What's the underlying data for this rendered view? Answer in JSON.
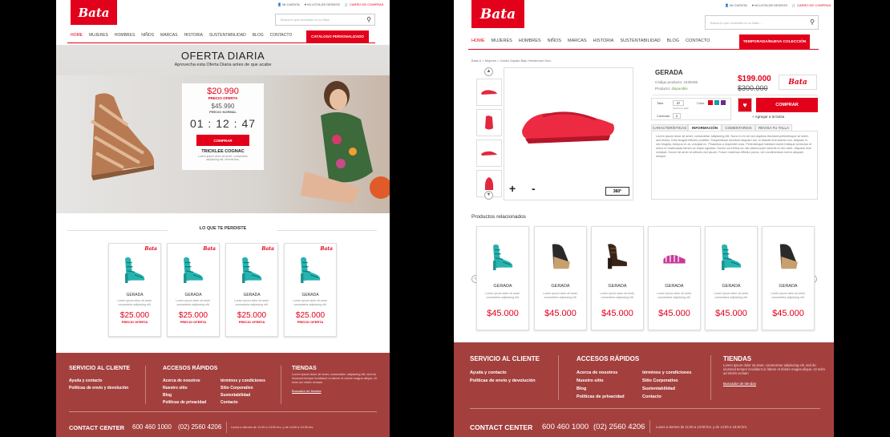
{
  "brand": {
    "logo": "Bata",
    "accent": "#e2001a",
    "footer_bg": "#a3403e"
  },
  "topbar": {
    "account": "MI CUENTA",
    "wishlist": "MI LISTA DE DESEOS",
    "cart": "CARRO DE COMPRAS"
  },
  "search": {
    "placeholder": "Busca lo que necesites en tu Bata...",
    "placeholder2": "Busca lo que necesites en tu Bata..."
  },
  "nav": {
    "items": [
      "HOME",
      "MUJERES",
      "HOMBRES",
      "NIÑOS",
      "MARCAS",
      "HISTORIA",
      "SUSTENTABILIDAD",
      "BLOG",
      "CONTACTO"
    ],
    "cta1": "CATÁLOGO PERSONALIZADO",
    "cta2": "TEMPORADA/NUEVA COLECCIÓN"
  },
  "offer": {
    "title": "OFERTA DIARIA",
    "subtitle": "Aprovecha esta Oferta Diaria antes de que acabe",
    "price": "$20.990",
    "price_label": "PRECIO OFERTA",
    "normal_price": "$45.990",
    "normal_label": "PRECIO NORMAL",
    "countdown": "01 : 12 : 47",
    "buy": "COMPRAR",
    "product": "TRICKLEE COGNAC",
    "desc": "Lorem ipsum dolor sit amet, consectetur adipiscing elit. Viminis ties."
  },
  "missed": {
    "heading": "LO QUE TE PERDISTE",
    "cards": [
      {
        "name": "GERADA",
        "desc": "Lorem ipsum dolor sit amet, consectetur adipiscing elit.",
        "price": "$25.000",
        "label": "PRECIO OFERTA"
      },
      {
        "name": "GERADA",
        "desc": "Lorem ipsum dolor sit amet, consectetur adipiscing elit.",
        "price": "$25.000",
        "label": "PRECIO OFERTA"
      },
      {
        "name": "GERADA",
        "desc": "Lorem ipsum dolor sit amet, consectetur adipiscing elit.",
        "price": "$25.000",
        "label": "PRECIO OFERTA"
      },
      {
        "name": "GERADA",
        "desc": "Lorem ipsum dolor sit amet, consectetur adipiscing elit.",
        "price": "$25.000",
        "label": "PRECIO OFERTA"
      }
    ]
  },
  "footer": {
    "service_title": "SERVICIO AL CLIENTE",
    "service_links": [
      "Ayuda y contacto",
      "Políticas de envío y devolución"
    ],
    "quick_title": "ACCESOS RÁPIDOS",
    "quick_col1": [
      "Acerca de nosotros",
      "Nuestro sitio",
      "Blog",
      "Políticas de privacidad"
    ],
    "quick_col2": [
      "términos y condiciones",
      "Sitio Corporativo",
      "Sustentabilidad",
      "Contacto"
    ],
    "stores_title": "TIENDAS",
    "stores_text": "Lorem ipsum dolor sit amet, consectetur adipiscing elit, sed do eiusmod tempor incididunt ut labore et dolore magna aliqua. Ut enim ad minim veniam",
    "stores_link": "Buscador de tiendas",
    "contact_label": "CONTACT CENTER",
    "phone1": "600 460 1000",
    "phone2": "(02) 2560 4206",
    "hours": "Lunes a viernes de 11:00 a 13:00 hrs. y de 14:00 a 19:30 hrs."
  },
  "product": {
    "breadcrumb": "Bata.cl  >  Mujeres  >  Clarks Zapato Bajo Henderson Dico",
    "name": "GERADA",
    "code": "Código producto: 2439436",
    "availability_label": "Producto:",
    "availability": "disponible",
    "price": "$199.000",
    "old_price": "$300.000",
    "size_label": "Talla",
    "size_value": "37",
    "size_help": "Verifica tu talla",
    "color_label": "Color",
    "qty_label": "Cantidad",
    "qty_value": "2",
    "buy": "COMPRAR",
    "add_bag": "+ Agregar a la bolsa",
    "tabs": [
      "CARACTERÍSTICAS",
      "INFORMACIÓN",
      "COMENTARIOS",
      "REVISA TU TALLA"
    ],
    "tab_text": "Lorem ipsum dolor sit amet, consectetur adipiscing elit. Nunc in mi vel dui dapibus tincidunt pellentesque at lorem sed lectus. Duis feugiat efficitur porttitor. Suspendisse tincidunt aliquam dui, in blandit erat lacinia non. Aliquam in nisi fringilla, tempus ex at, volutpat ex. Phasellus a imperdiet urna. Pellentesque habitant morbi tristique senectus et netus et malesuada fames ac turpis egestas. Donec sed tellus ac nisi ullamcorper lobortis et nec ante. Aliquam erat volutpat. Donec sit amet ut ultrices nisl ipsum. Fusce maximus efficitur purus, vel condimentum lorem aliquam semper.",
    "zoom_in": "+",
    "zoom_out": "-",
    "rotate": "360°",
    "colors": [
      "#e2001a",
      "#1a9bb0",
      "#6a2c8c"
    ]
  },
  "related": {
    "heading": "Productos relacionados",
    "cards": [
      {
        "name": "GERADA",
        "desc": "Lorem ipsum dolor sit amet, consectetur adipiscing elit.",
        "price": "$45.000"
      },
      {
        "name": "GERADA",
        "desc": "Lorem ipsum dolor sit amet, consectetur adipiscing elit.",
        "price": "$45.000"
      },
      {
        "name": "GERADA",
        "desc": "Lorem ipsum dolor sit amet, consectetur adipiscing elit.",
        "price": "$45.000"
      },
      {
        "name": "GERADA",
        "desc": "Lorem ipsum dolor sit amet, consectetur adipiscing elit.",
        "price": "$45.000"
      },
      {
        "name": "GERADA",
        "desc": "Lorem ipsum dolor sit amet, consectetur adipiscing elit.",
        "price": "$45.000"
      },
      {
        "name": "GERADA",
        "desc": "Lorem ipsum dolor sit amet, consectetur adipiscing elit.",
        "price": "$45.000"
      }
    ]
  }
}
